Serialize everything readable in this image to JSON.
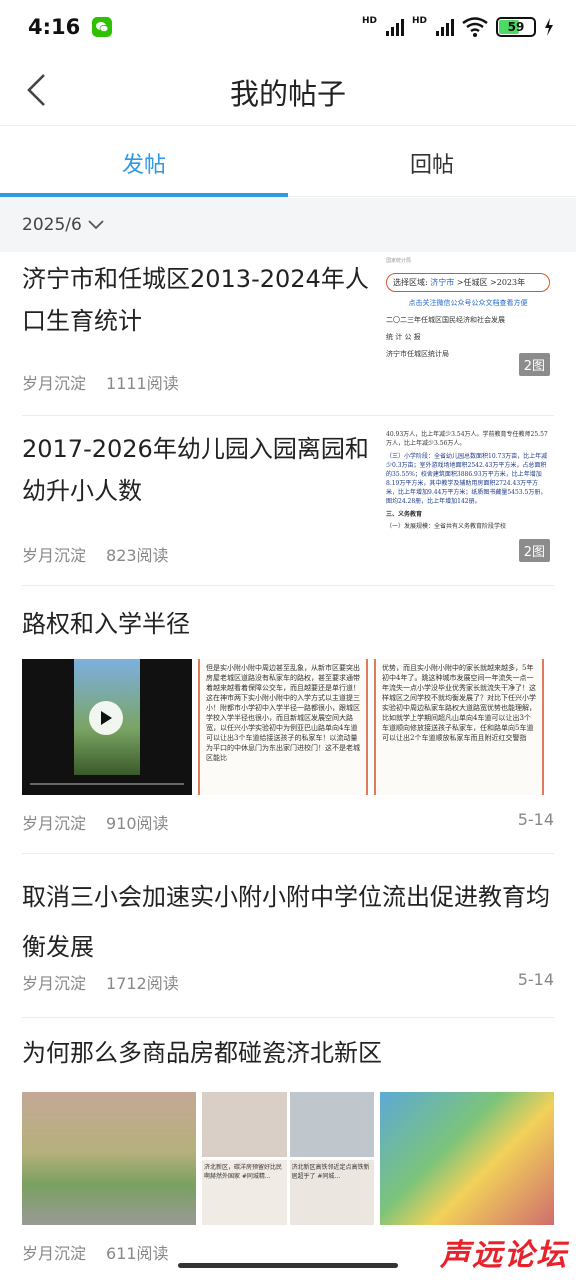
{
  "status_bar": {
    "time": "4:16",
    "battery": "59",
    "network_1": "HD",
    "network_2": "HD"
  },
  "header": {
    "title": "我的帖子"
  },
  "tabs": [
    {
      "label": "发帖",
      "active": true
    },
    {
      "label": "回帖",
      "active": false
    }
  ],
  "filter": {
    "date": "2025/6"
  },
  "posts": [
    {
      "title": "济宁市和任城区2013-2024年人口生育统计",
      "author": "岁月沉淀",
      "views": "1111阅读",
      "image_count": "2图",
      "thumb": {
        "line1": "选择区域:",
        "region1": "济宁市",
        "region2": "任城区",
        "year": "2023年",
        "link": "点击关注微信公众号公众文档查看方便",
        "heading": "二〇二三年任城区国民经济和社会发展",
        "sub": "统 计 公 报",
        "org": "济宁市任城区统计局"
      }
    },
    {
      "title": "2017-2026年幼儿园入园离园和幼升小人数",
      "author": "岁月沉淀",
      "views": "823阅读",
      "image_count": "2图",
      "thumb": {
        "p1": "40.93万人，比上年减少3.54万人。学前教育专任教师25.57万人，比上年减少3.56万人。",
        "p2": "（三）小学阶段：全省幼儿园总数面积10.73万亩，比上年减少0.3万亩；室外游戏场地面积2542.43万平方米，占总面积的35.55%；校舍建筑面积3886.93万平方米，比上年增加8.19万平方米，其中教学及辅助用房面积2724.43万平方米，比上年增加9.44万平方米；纸质图书藏量5453.5万册，图均24.28册，比上年增加142册。",
        "p3": "三、义务教育",
        "p4": "（一）发展规模：全省共有义务教育阶段学校"
      }
    },
    {
      "title": "路权和入学半径",
      "author": "岁月沉淀",
      "views": "910阅读",
      "date": "5-14",
      "text_a": "但是实小附小附中周边甚至乱象，从新市区要突出房屋老城区道路没有私家车的路权，甚至要求通带着越来越看着保障公交车，而且越要还是单行道！这在神市两下实小附小附中的入学方式以主道提三小！附都市小学初中入学半径一路都很小，跟城区学校入学半径也很小，而且新城区发展空间大路宽，以任兴小学实验初中为例亚巴山路单向4车道可以让出3个车道给接送孩子的私家车！以流动量为平口的中休息门为东出家门进校门！这不是老城区能比",
      "text_b": "优势，而且实小附小附中的家长就越来越多，5年初中4年了。跳这种城市发展空间一年流失一点一年流失一点小学没毕业优秀家长就流失干净了！这样城区之间学校不就均衡发展了？对比下任兴小学实验初中周边私家车路权大道路宽优势也能理解，比如就学上学期间超凡山单向4车道可以让出3个车道顺向修放接送孩子私家车，任和路单向5车道可以让出2个车道顺放私家车而且附近红交警指"
    },
    {
      "title": "取消三小会加速实小附小附中学位流出促进教育均衡发展",
      "author": "岁月沉淀",
      "views": "1712阅读",
      "date": "5-14"
    },
    {
      "title": "为何那么多商品房都碰瓷济北新区",
      "author": "岁月沉淀",
      "views": "611阅读",
      "pic_caption_1": "济北新区，碳洋房预留好比民啊赫然外国家 #同城精...",
      "pic_caption_2": "济北新区高铁邻近定点高铁新居超乎了 #同城..."
    }
  ],
  "watermark": "声远论坛"
}
